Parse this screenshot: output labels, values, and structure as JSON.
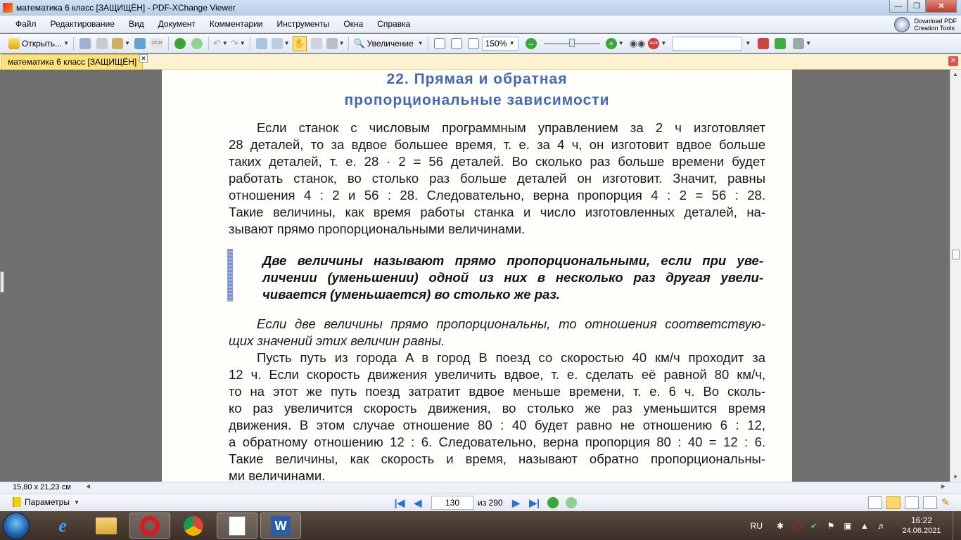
{
  "window": {
    "title": "математика 6 класс [ЗАЩИЩЁН] - PDF-XChange Viewer",
    "controls": [
      "minimize",
      "maximize",
      "close"
    ]
  },
  "menu": {
    "items": [
      "Файл",
      "Редактирование",
      "Вид",
      "Документ",
      "Комментарии",
      "Инструменты",
      "Окна",
      "Справка"
    ],
    "download_pdf": [
      "Download PDF",
      "Creation Tools"
    ]
  },
  "toolbar": {
    "open_label": "Открыть...",
    "zoom_label": "Увеличение",
    "zoom_value": "150%"
  },
  "tab": {
    "label": "математика 6 класс [ЗАЩИЩЁН]"
  },
  "document": {
    "heading_line1": "22. Прямая и обратная",
    "heading_line2": "пропорциональные зависимости",
    "para1": [
      "Если станок с числовым программным управлением за 2 ч изготовляет",
      "28 деталей, то за вдвое большее время, т. е. за 4 ч, он изготовит вдвое больше",
      "таких деталей, т. е. 28 · 2 = 56 деталей. Во сколько раз больше времени будет",
      "работать станок, во столько раз больше деталей он изготовит. Значит, равны",
      "отношения 4 : 2 и 56 : 28. Следовательно, верна пропорция 4 : 2 = 56 : 28.",
      "Такие величины, как время работы станка и число изготовленных деталей, на-",
      "зывают прямо пропорциональными величинами."
    ],
    "rule": [
      "Две величины называют прямо пропорциональными, если при уве-",
      "личении (уменьшении) одной из них в несколько раз другая увели-",
      "чивается (уменьшается) во столько же раз."
    ],
    "para2": [
      "Если две величины прямо пропорциональны, то отношения соответствую-",
      "щих значений этих величин равны."
    ],
    "para3": [
      "Пусть путь из города A в город B поезд со скоростью 40 км/ч проходит за",
      "12 ч. Если скорость движения увеличить вдвое, т. е. сделать её равной 80 км/ч,",
      "то на этот же путь поезд затратит вдвое меньше времени, т. е. 6 ч. Во сколь-",
      "ко раз увеличится скорость движения, во столько же раз уменьшится время",
      "движения. В этом случае отношение 80 : 40 будет равно не отношению 6 : 12,",
      "а обратному отношению 12 : 6. Следовательно, верна пропорция 80 : 40 = 12 : 6.",
      "Такие величины, как скорость и время, называют обратно пропорциональны-",
      "ми величинами."
    ]
  },
  "status": {
    "page_size": "15,80 x 21,23 см"
  },
  "nav": {
    "params_label": "Параметры",
    "current_page": "130",
    "of_total": "из 290"
  },
  "taskbar": {
    "apps": [
      "internet-explorer",
      "file-explorer",
      "opera",
      "chrome",
      "pdf-xchange-viewer",
      "word"
    ],
    "lang": "RU",
    "time": "16:22",
    "date": "24.06.2021"
  },
  "colors": {
    "heading": "#4169b8",
    "tab_active": "#ffe27a",
    "rule_bar": "#7c93d4"
  }
}
